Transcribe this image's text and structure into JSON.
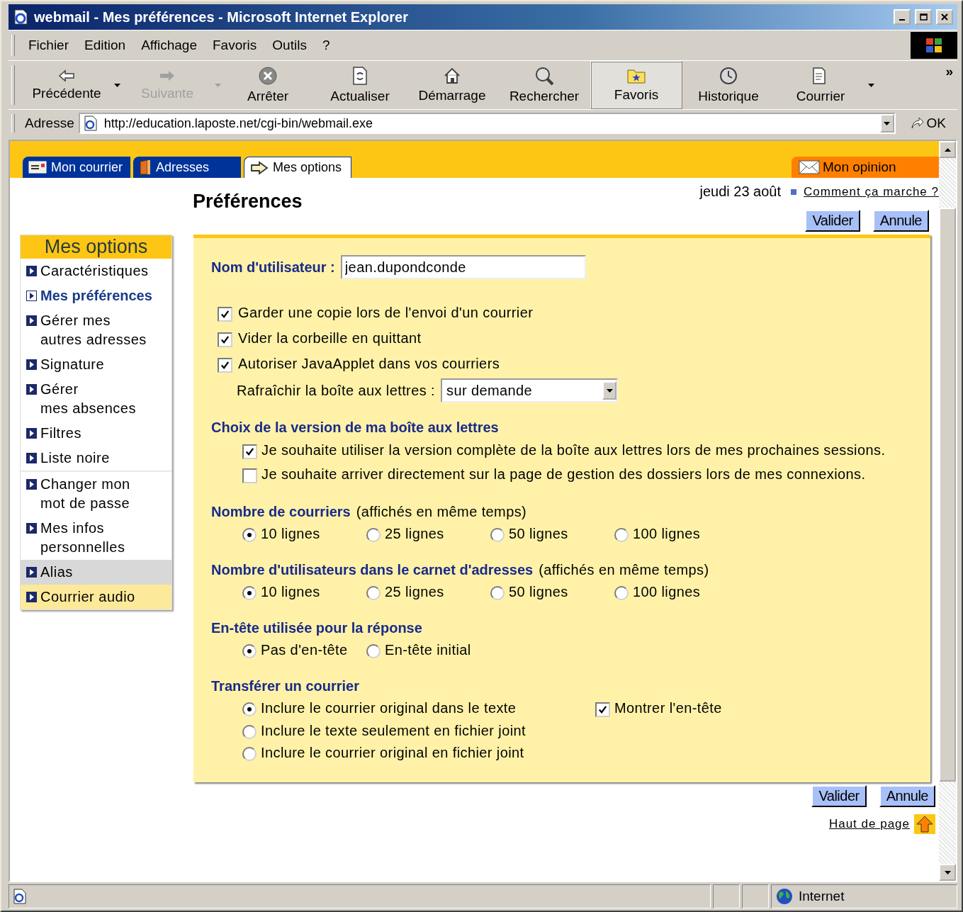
{
  "window": {
    "title": "webmail - Mes préférences - Microsoft Internet Explorer"
  },
  "menu": [
    "Fichier",
    "Edition",
    "Affichage",
    "Favoris",
    "Outils",
    "?"
  ],
  "toolbar": {
    "buttons": [
      {
        "label": "Précédente",
        "kind": "back",
        "disabled": false,
        "selected": false,
        "dropdown": true
      },
      {
        "label": "Suivante",
        "kind": "forward",
        "disabled": true,
        "selected": false,
        "dropdown": true
      },
      {
        "label": "Arrêter",
        "kind": "stop",
        "disabled": false,
        "selected": false,
        "dropdown": false
      },
      {
        "label": "Actualiser",
        "kind": "refresh",
        "disabled": false,
        "selected": false,
        "dropdown": false
      },
      {
        "label": "Démarrage",
        "kind": "home",
        "disabled": false,
        "selected": false,
        "dropdown": false
      },
      {
        "label": "Rechercher",
        "kind": "search",
        "disabled": false,
        "selected": false,
        "dropdown": false
      },
      {
        "label": "Favoris",
        "kind": "favorites",
        "disabled": false,
        "selected": true,
        "dropdown": false
      },
      {
        "label": "Historique",
        "kind": "history",
        "disabled": false,
        "selected": false,
        "dropdown": false
      },
      {
        "label": "Courrier",
        "kind": "mail",
        "disabled": false,
        "selected": false,
        "dropdown": true
      }
    ],
    "more": "»"
  },
  "address": {
    "label": "Adresse",
    "url": "http://education.laposte.net/cgi-bin/webmail.exe",
    "go": "OK"
  },
  "tabs": [
    {
      "label": "Mon courrier",
      "kind": "mail",
      "selected": false
    },
    {
      "label": "Adresses",
      "kind": "book",
      "selected": false
    },
    {
      "label": "Mes options",
      "kind": "arrow",
      "selected": true
    }
  ],
  "opinion_tab": {
    "label": "Mon opinion"
  },
  "date": "jeudi 23 août",
  "help_link": "Comment ça marche ?",
  "page_title": "Préférences",
  "buttons_top": [
    "Valider",
    "Annule"
  ],
  "sidebar": {
    "title": "Mes options",
    "items": [
      {
        "label": "Caractéristiques",
        "selected": false,
        "color": "#ffffff",
        "divider_before": false
      },
      {
        "label": "Mes préférences",
        "selected": true,
        "color": "#ffffff",
        "divider_before": false
      },
      {
        "label": "Gérer mes\nautres adresses",
        "selected": false,
        "color": "#ffffff",
        "divider_before": false
      },
      {
        "label": "Signature",
        "selected": false,
        "color": "#ffffff",
        "divider_before": false
      },
      {
        "label": "Gérer\nmes absences",
        "selected": false,
        "color": "#ffffff",
        "divider_before": false
      },
      {
        "label": "Filtres",
        "selected": false,
        "color": "#ffffff",
        "divider_before": false
      },
      {
        "label": "Liste noire",
        "selected": false,
        "color": "#ffffff",
        "divider_before": false
      },
      {
        "label": "Changer mon\nmot de passe",
        "selected": false,
        "color": "#ffffff",
        "divider_before": true
      },
      {
        "label": "Mes infos\npersonnelles",
        "selected": false,
        "color": "#ffffff",
        "divider_before": false
      },
      {
        "label": "Alias",
        "selected": false,
        "color": "#d8d8d8",
        "divider_before": false
      },
      {
        "label": "Courrier audio",
        "selected": false,
        "color": "#fde99a",
        "divider_before": false
      }
    ]
  },
  "form": {
    "username": {
      "label": "Nom d'utilisateur :",
      "value": "jean.dupondconde"
    },
    "checks": [
      {
        "label": "Garder une copie lors de l'envoi d'un courrier",
        "checked": true
      },
      {
        "label": "Vider la corbeille en quittant",
        "checked": true
      },
      {
        "label": "Autoriser JavaApplet dans vos courriers",
        "checked": true
      }
    ],
    "refresh": {
      "label": "Rafraîchir la boîte aux lettres :",
      "value": "sur demande"
    },
    "sections": [
      {
        "title": "Choix de la version de ma boîte aux lettres",
        "kind": "checks",
        "options": [
          {
            "label": "Je souhaite utiliser la version complète de la boîte aux lettres lors de mes prochaines sessions.",
            "checked": true
          },
          {
            "label": "Je souhaite arriver directement sur la page de gestion des dossiers lors de mes connexions.",
            "checked": false
          }
        ]
      },
      {
        "title": "Nombre de courriers",
        "note": "(affichés en même temps)",
        "kind": "radios",
        "options": [
          {
            "label": "10 lignes",
            "selected": true
          },
          {
            "label": "25 lignes",
            "selected": false
          },
          {
            "label": "50 lignes",
            "selected": false
          },
          {
            "label": "100 lignes",
            "selected": false
          }
        ]
      },
      {
        "title": "Nombre d'utilisateurs dans le carnet d'adresses",
        "note": "(affichés en même temps)",
        "kind": "radios",
        "options": [
          {
            "label": "10 lignes",
            "selected": true
          },
          {
            "label": "25 lignes",
            "selected": false
          },
          {
            "label": "50 lignes",
            "selected": false
          },
          {
            "label": "100 lignes",
            "selected": false
          }
        ]
      },
      {
        "title": "En-tête utilisée pour la réponse",
        "kind": "radios",
        "options": [
          {
            "label": "Pas d'en-tête",
            "selected": true
          },
          {
            "label": "En-tête initial",
            "selected": false
          }
        ]
      },
      {
        "title": "Transférer un courrier",
        "kind": "radio-column",
        "options": [
          {
            "label": "Inclure le courrier original dans le texte",
            "selected": true,
            "check": {
              "label": "Montrer l'en-tête",
              "checked": true
            }
          },
          {
            "label": "Inclure le texte seulement en fichier joint",
            "selected": false
          },
          {
            "label": "Inclure le courrier original en fichier joint",
            "selected": false
          }
        ]
      }
    ]
  },
  "buttons_bottom": [
    "Valider",
    "Annule"
  ],
  "top_link": "Haut de page",
  "status_bar": {
    "zone": "Internet"
  }
}
